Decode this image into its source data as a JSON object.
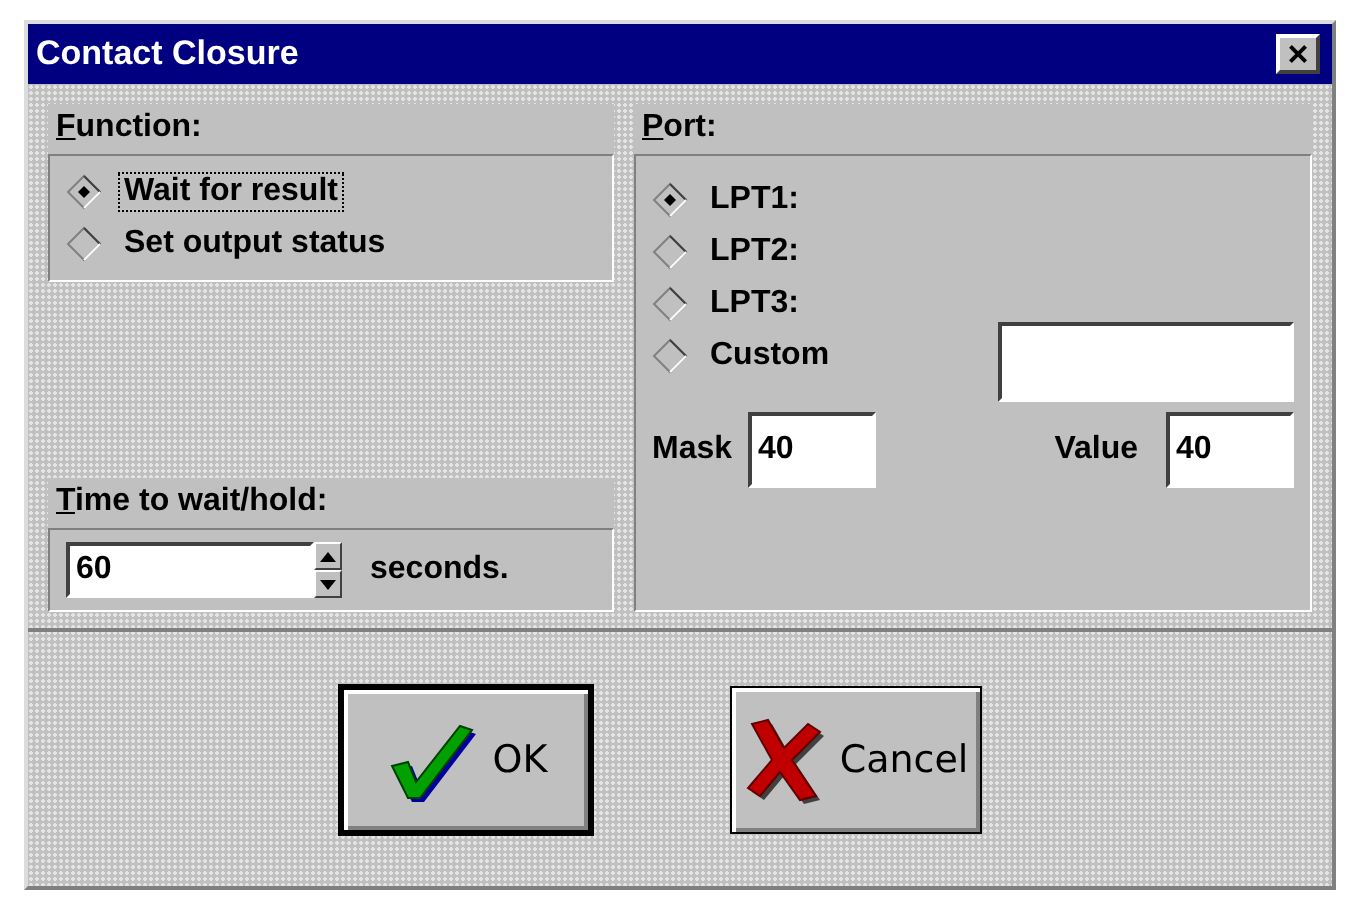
{
  "window": {
    "title": "Contact Closure",
    "close_glyph": "×"
  },
  "function_group": {
    "label": "Function:",
    "options": [
      {
        "label": "Wait for result",
        "selected": true,
        "focused": true
      },
      {
        "label": "Set output status",
        "selected": false,
        "focused": false
      }
    ]
  },
  "time_group": {
    "label": "Time to wait/hold:",
    "value": "60",
    "unit": "seconds."
  },
  "port_group": {
    "label": "Port:",
    "options": [
      {
        "label": "LPT1:",
        "selected": true
      },
      {
        "label": "LPT2:",
        "selected": false
      },
      {
        "label": "LPT3:",
        "selected": false
      },
      {
        "label": "Custom",
        "selected": false
      }
    ],
    "mask_label": "Mask",
    "mask_value": "40",
    "value_label": "Value",
    "value_value": "40"
  },
  "buttons": [
    {
      "kind": "ok",
      "label": "OK",
      "default": true
    },
    {
      "kind": "cancel",
      "label": "Cancel",
      "default": false
    }
  ]
}
